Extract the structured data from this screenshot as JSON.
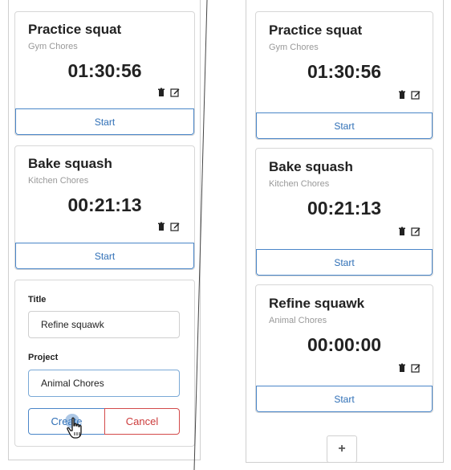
{
  "left_panel": {
    "timers": [
      {
        "title": "Practice squat",
        "project": "Gym Chores",
        "elapsed": "01:30:56",
        "action_label": "Start"
      },
      {
        "title": "Bake squash",
        "project": "Kitchen Chores",
        "elapsed": "00:21:13",
        "action_label": "Start"
      }
    ],
    "form": {
      "title_label": "Title",
      "title_value": "Refine squawk",
      "project_label": "Project",
      "project_value": "Animal Chores",
      "create_label": "Create",
      "cancel_label": "Cancel"
    }
  },
  "right_panel": {
    "timers": [
      {
        "title": "Practice squat",
        "project": "Gym Chores",
        "elapsed": "01:30:56",
        "action_label": "Start"
      },
      {
        "title": "Bake squash",
        "project": "Kitchen Chores",
        "elapsed": "00:21:13",
        "action_label": "Start"
      },
      {
        "title": "Refine squawk",
        "project": "Animal Chores",
        "elapsed": "00:00:00",
        "action_label": "Start"
      }
    ],
    "add_label": "+"
  },
  "icons": {
    "delete": "trash-icon",
    "edit": "edit-icon",
    "cursor": "hand-pointer-icon"
  },
  "colors": {
    "primary": "#2f6fb6",
    "danger": "#cc3b3b",
    "border": "#d7d7d7",
    "muted": "#999999"
  }
}
